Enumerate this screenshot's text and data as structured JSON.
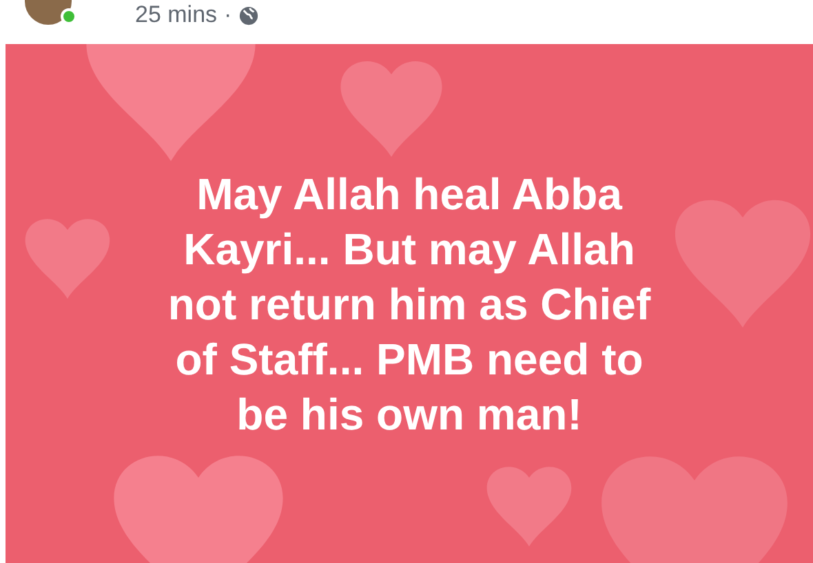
{
  "post": {
    "time": "25 mins",
    "separator": "·",
    "avatar_online": true
  },
  "card": {
    "text": "May Allah heal Abba Kayri... But may Allah not return him as Chief of Staff... PMB need to be his own man!"
  }
}
